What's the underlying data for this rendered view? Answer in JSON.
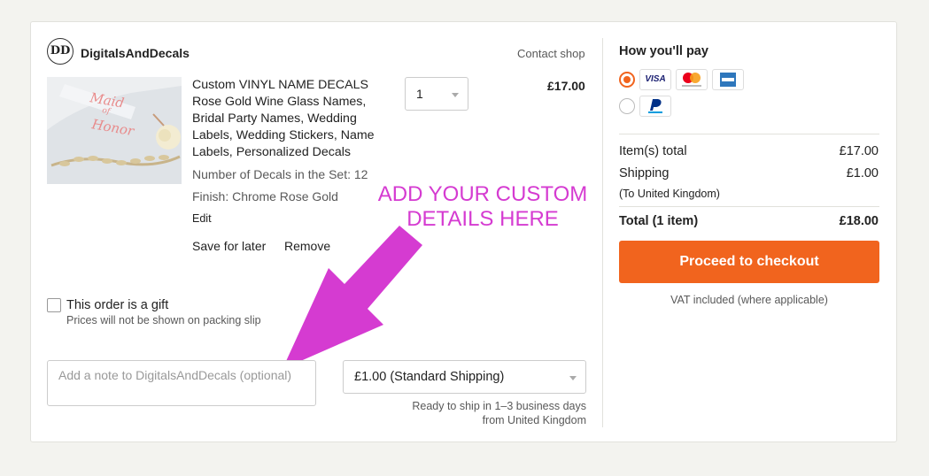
{
  "shop": {
    "logo_text": "DD",
    "name": "DigitalsAndDecals",
    "contact_label": "Contact shop"
  },
  "item": {
    "title": "Custom VINYL NAME DECALS Rose Gold Wine Glass Names, Bridal Party Names, Wedding Labels, Wedding Stickers, Name Labels, Personalized Decals",
    "image_text": "Maid of Honor",
    "variation_1": "Number of Decals in the Set: 12",
    "variation_2": "Finish: Chrome Rose Gold",
    "edit_label": "Edit",
    "save_for_later": "Save for later",
    "remove": "Remove",
    "quantity": "1",
    "price": "£17.00"
  },
  "annotation": {
    "text": "ADD YOUR CUSTOM DETAILS HERE",
    "color": "#d53bd1"
  },
  "gift": {
    "label": "This order is a gift",
    "sub": "Prices will not be shown on packing slip"
  },
  "note": {
    "placeholder": "Add a note to DigitalsAndDecals (optional)"
  },
  "shipping": {
    "selected": "£1.00 (Standard Shipping)",
    "ready_line1": "Ready to ship in 1–3 business days",
    "ready_line2": "from United Kingdom"
  },
  "payment": {
    "heading": "How you'll pay",
    "methods": [
      "VISA",
      "Mastercard",
      "AMEX",
      "PayPal"
    ],
    "accent": "#f1641e"
  },
  "summary": {
    "items_total_label": "Item(s) total",
    "items_total_value": "£17.00",
    "shipping_label": "Shipping",
    "shipping_value": "£1.00",
    "shipping_dest": "(To United Kingdom)",
    "total_label": "Total (1 item)",
    "total_value": "£18.00",
    "checkout_label": "Proceed to checkout",
    "vat_note": "VAT included (where applicable)"
  }
}
